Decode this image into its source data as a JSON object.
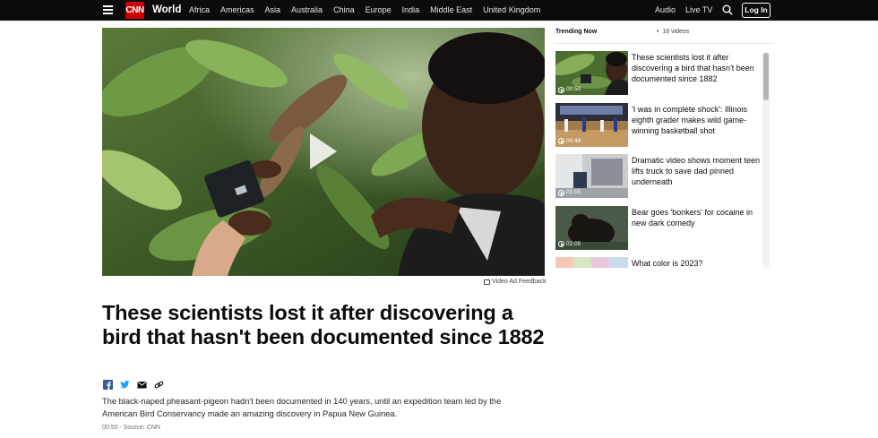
{
  "nav": {
    "logo": "CNN",
    "section": "World",
    "links": [
      "Africa",
      "Americas",
      "Asia",
      "Australia",
      "China",
      "Europe",
      "India",
      "Middle East",
      "United Kingdom"
    ],
    "audio": "Audio",
    "live_tv": "Live TV",
    "login": "Log In"
  },
  "player": {
    "ad_feedback": "Video Ad Feedback"
  },
  "article": {
    "headline": "These scientists lost it after discovering a bird that hasn't been documented since 1882",
    "summary": "The black-naped pheasant-pigeon hadn't been documented in 140 years, until an expedition team led by the American Bird Conservancy made an amazing discovery in Papua New Guinea.",
    "meta": "00:50 - Source: CNN"
  },
  "trending": {
    "heading": "Trending Now",
    "count": "16 videos",
    "items": [
      {
        "title": "These scientists lost it after discovering a bird that hasn't been documented since 1882",
        "duration": "00:50"
      },
      {
        "title": "'I was in complete shock': Illinois eighth grader makes wild game-winning basketball shot",
        "duration": "00:48"
      },
      {
        "title": "Dramatic video shows moment teen lifts truck to save dad pinned underneath",
        "duration": "01:55"
      },
      {
        "title": "Bear goes 'bonkers' for cocaine in new dark comedy",
        "duration": "02:05"
      },
      {
        "title": "What color is 2023?",
        "duration": ""
      }
    ]
  },
  "colors": {
    "brand_red": "#cc0000",
    "nav_bg": "#0c0c0c"
  }
}
